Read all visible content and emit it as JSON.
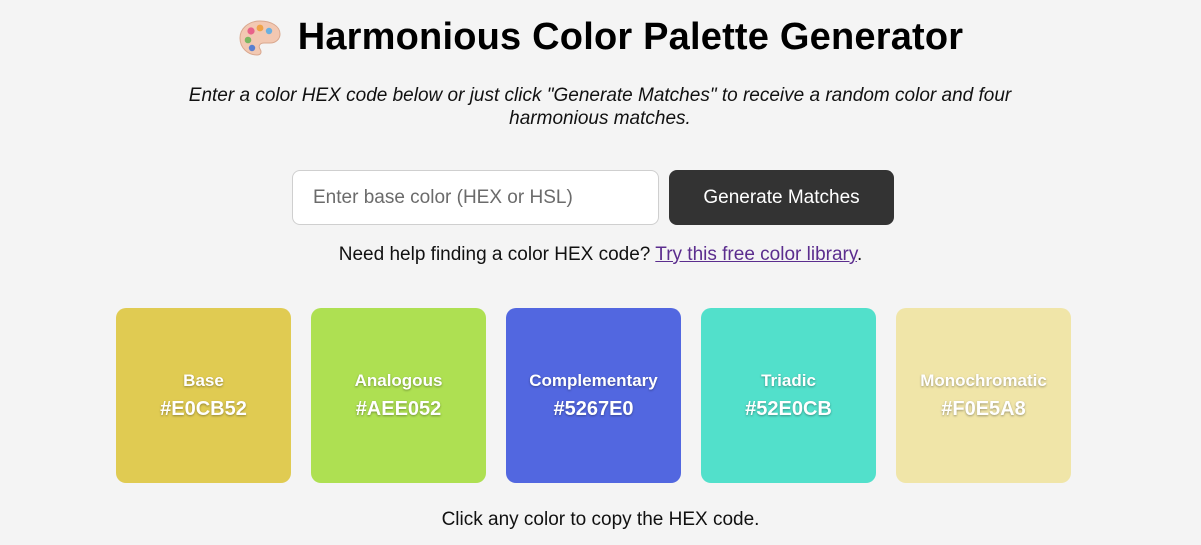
{
  "header": {
    "title": "Harmonious Color Palette Generator",
    "icon": "artist-palette-icon",
    "subtitle": "Enter a color HEX code below or just click \"Generate Matches\" to receive a random color and four harmonious matches."
  },
  "controls": {
    "input_placeholder": "Enter base color (HEX or HSL)",
    "input_value": "",
    "generate_label": "Generate Matches"
  },
  "help": {
    "text": "Need help finding a color HEX code? ",
    "link_text": "Try this free color library",
    "suffix": "."
  },
  "swatches": [
    {
      "name": "Base",
      "hex": "#E0CB52",
      "color": "#E0CB52"
    },
    {
      "name": "Analogous",
      "hex": "#AEE052",
      "color": "#AEE052"
    },
    {
      "name": "Complementary",
      "hex": "#5267E0",
      "color": "#5267E0"
    },
    {
      "name": "Triadic",
      "hex": "#52E0CB",
      "color": "#52E0CB"
    },
    {
      "name": "Monochromatic",
      "hex": "#F0E5A8",
      "color": "#F0E5A8"
    }
  ],
  "footer": {
    "note": "Click any color to copy the HEX code."
  },
  "colors": {
    "background": "#f4f4f4",
    "button": "#333333",
    "link": "#5b2d8e"
  }
}
